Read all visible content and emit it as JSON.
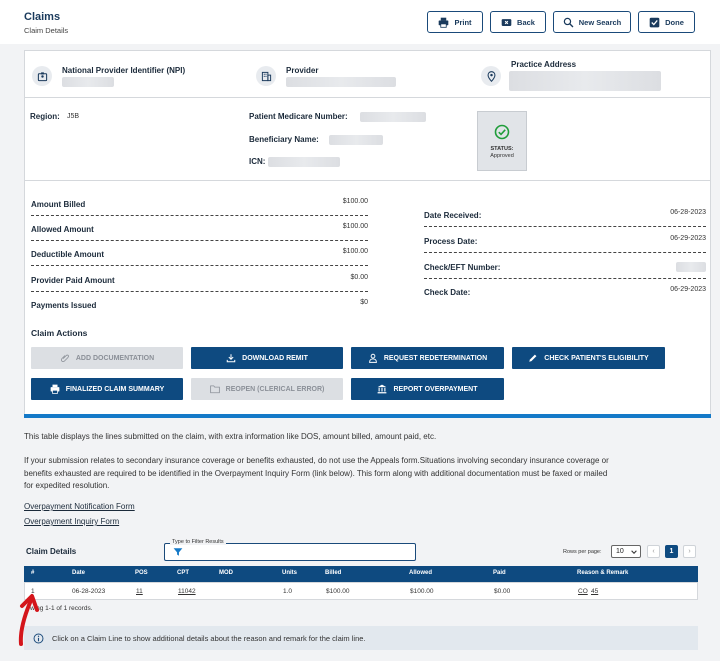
{
  "header": {
    "title": "Claims",
    "subtitle": "Claim Details",
    "buttons": {
      "print": "Print",
      "back": "Back",
      "new_search": "New Search",
      "done": "Done"
    }
  },
  "provider_info": {
    "npi_label": "National Provider Identifier (NPI)",
    "provider_label": "Provider",
    "address_label": "Practice Address"
  },
  "claim_info": {
    "region_label": "Region:",
    "region_value": "J5B",
    "mbi_label": "Patient Medicare Number:",
    "beneficiary_label": "Beneficiary Name:",
    "icn_label": "ICN:",
    "status_label": "STATUS:",
    "status_value": "Approved"
  },
  "amounts": [
    {
      "label": "Amount Billed",
      "value": "$100.00"
    },
    {
      "label": "Allowed Amount",
      "value": "$100.00"
    },
    {
      "label": "Deductible Amount",
      "value": "$100.00"
    },
    {
      "label": "Provider Paid Amount",
      "value": "$0.00"
    },
    {
      "label": "Payments Issued",
      "value": "$0"
    }
  ],
  "dates": [
    {
      "label": "Date Received:",
      "value": "06-28-2023"
    },
    {
      "label": "Process Date:",
      "value": "06-29-2023"
    },
    {
      "label": "Check/EFT Number:",
      "value": ""
    },
    {
      "label": "Check Date:",
      "value": "06-29-2023"
    }
  ],
  "claim_actions": {
    "heading": "Claim Actions",
    "add_documentation": "ADD DOCUMENTATION",
    "download_remit": "DOWNLOAD REMIT",
    "request_redetermination": "REQUEST REDETERMINATION",
    "check_eligibility": "CHECK PATIENT'S ELIGIBILITY",
    "finalized_summary": "FINALIZED CLAIM SUMMARY",
    "reopen": "REOPEN (CLERICAL ERROR)",
    "report_overpayment": "REPORT OVERPAYMENT"
  },
  "info_text": {
    "para1": "This table displays the lines submitted on the claim, with extra information like DOS, amount billed, amount paid, etc.",
    "para2_line1": "If your submission relates to secondary insurance coverage or benefits exhausted, do not use the Appeals form.Situations involving secondary insurance coverage or",
    "para2_line2": "benefits exhausted are required to be identified in the Overpayment Inquiry Form (link below). This form along with additional documentation must be faxed or mailed",
    "para2_line3": "for expedited resolution.",
    "link1": "Overpayment Notification Form",
    "link2": "Overpayment Inquiry Form"
  },
  "table": {
    "title": "Claim Details",
    "filter_label": "Type to Filter Results",
    "rows_per_page_label": "Rows per page:",
    "rows_per_page": "10",
    "current_page": "1",
    "columns": [
      "#",
      "Date",
      "POS",
      "CPT",
      "MOD",
      "Units",
      "Billed",
      "Allowed",
      "Paid",
      "Reason & Remark"
    ],
    "rows": [
      {
        "num": "1",
        "date": "06-28-2023",
        "pos": "11",
        "cpt": "11042",
        "mod": "",
        "units": "1.0",
        "billed": "$100.00",
        "allowed": "$100.00",
        "paid": "$0.00",
        "reason": "CO",
        "remark": "45"
      }
    ],
    "showing": "wing 1-1 of 1 records."
  },
  "footer_note": "Click on a Claim Line to show additional details about the reason and remark for the claim line.",
  "colors": {
    "primary": "#0e4a80",
    "accent_bar": "#1479c8",
    "annotation_arrow": "#d4151b"
  }
}
